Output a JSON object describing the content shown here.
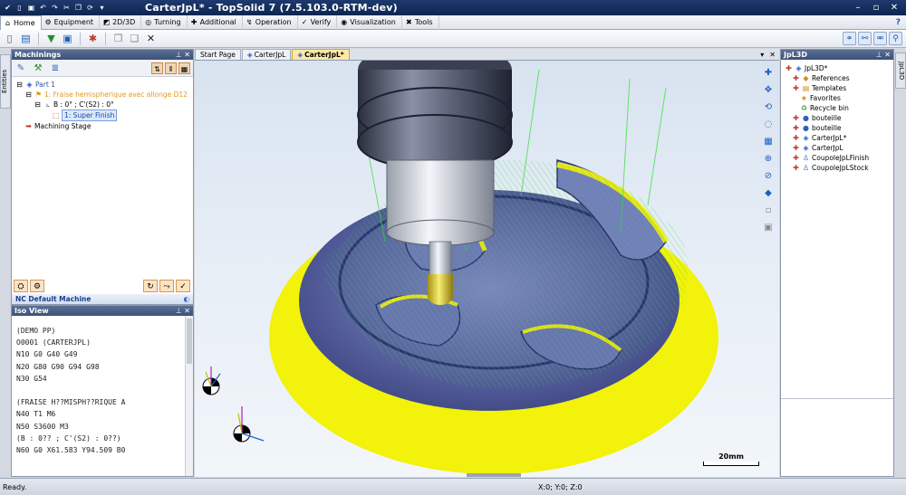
{
  "app": {
    "title": "CarterJpL* - TopSolid 7 (7.5.103.0-RTM-dev)"
  },
  "ribbon": {
    "tabs": [
      {
        "label": "Home",
        "icon": "home-icon"
      },
      {
        "label": "Equipment",
        "icon": "equipment-icon"
      },
      {
        "label": "2D/3D",
        "icon": "2d3d-icon"
      },
      {
        "label": "Turning",
        "icon": "turning-icon"
      },
      {
        "label": "Additional",
        "icon": "additional-icon"
      },
      {
        "label": "Operation",
        "icon": "operation-icon"
      },
      {
        "label": "Verify",
        "icon": "verify-icon"
      },
      {
        "label": "Visualization",
        "icon": "visualization-icon"
      },
      {
        "label": "Tools",
        "icon": "tools-icon"
      }
    ]
  },
  "left": {
    "sidetab_label": "Entities",
    "machinings": {
      "title": "Machinings",
      "tree": {
        "part": "Part 1",
        "operation": "1: Fraise hemispherique avec allonge D12",
        "orientation": "B : 0° ; C'(S2) : 0°",
        "finish": "1: Super Finish",
        "stage": "Machining Stage"
      },
      "nc_machine": "NC Default Machine"
    },
    "iso": {
      "title": "Iso View",
      "lines": [
        "(DEMO PP)",
        "O0001 (CARTERJPL)",
        "N10 G0 G40 G49",
        "N20 G80 G90 G94 G98",
        "N30 G54",
        "",
        "(FRAISE H??MISPH??RIQUE A",
        "N40 T1 M6",
        "N50 S3600 M3",
        "(B : 0?? ; C'(S2) : 0??)",
        "N60 G0 X61.583 Y94.509 B0"
      ]
    }
  },
  "documents": {
    "tabs": [
      "Start Page",
      "CarterJpL",
      "CarterJpL*"
    ],
    "active_index": 2
  },
  "viewport": {
    "scale_label": "20mm"
  },
  "right": {
    "title": "JpL3D",
    "sidetab_label": "JpL3D",
    "tree": [
      "JpL3D*",
      "References",
      "Templates",
      "Favorites",
      "Recycle bin",
      "bouteille",
      "bouteille",
      "CarterJpL*",
      "CarterJpL",
      "CoupoleJpLFinish",
      "CoupoleJpLStock"
    ]
  },
  "status": {
    "text": "Ready.",
    "coords": "X:0; Y:0; Z:0"
  },
  "colors": {
    "toolpath_yellow": "#f2f20a",
    "toolpath_green": "#2ee02e",
    "part_blue": "#5f6aa8",
    "titlebar": "#0c2550"
  }
}
